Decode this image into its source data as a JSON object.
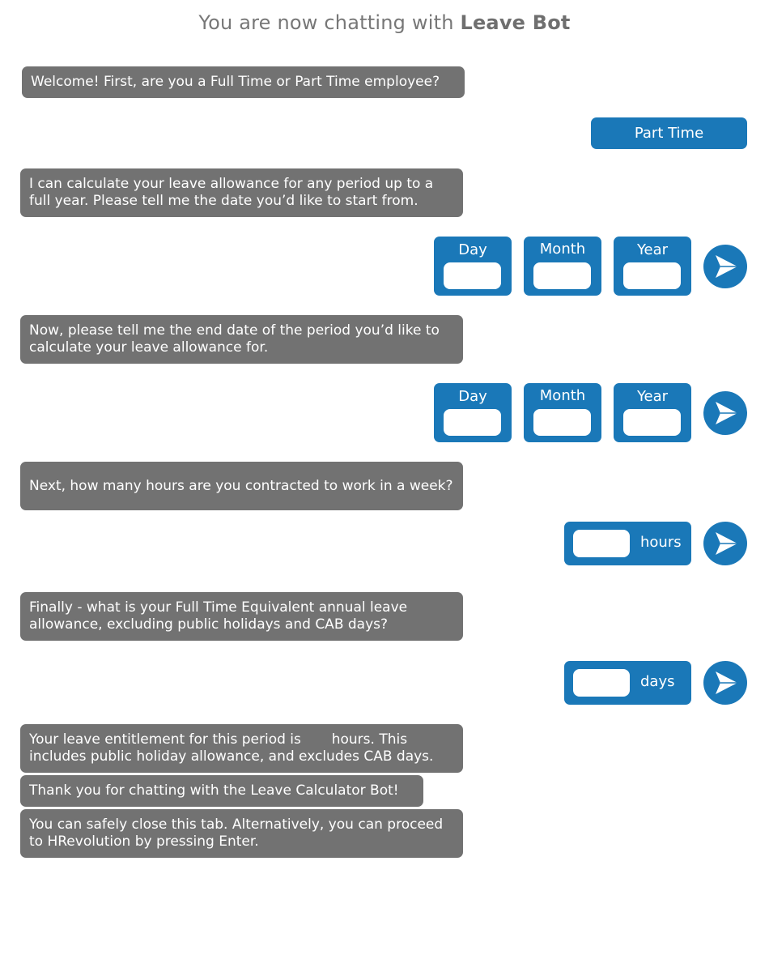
{
  "header": {
    "prefix": "You are now chatting with",
    "bot_name": "Leave Bot"
  },
  "messages": {
    "welcome": "Welcome! First, are you a Full Time or Part Time employee?",
    "start_prompt": "I can calculate your leave allowance for any period up to a full year. Please tell me the date you’d like to start from.",
    "end_prompt": "Now, please tell me the end date of the period you’d like to calculate your leave allowance for.",
    "hours_prompt": "Next, how many hours are you contracted to work in a week?",
    "fte_prompt": "Finally - what is your Full Time Equivalent annual leave allowance, excluding public holidays and CAB days?",
    "result": "Your leave entitlement for this period is       hours. This includes public holiday allowance, and excludes CAB days.",
    "thanks": "Thank you for chatting with the Leave Calculator Bot!",
    "closing": "You can safely close this tab. Alternatively, you can proceed to HRevolution by pressing Enter."
  },
  "user_reply": {
    "employment_type": "Part Time"
  },
  "date_labels": {
    "day": "Day",
    "month": "Month",
    "year": "Year"
  },
  "start_date": {
    "day": "",
    "month": "",
    "year": ""
  },
  "end_date": {
    "day": "",
    "month": "",
    "year": ""
  },
  "hours_input": {
    "value": "",
    "unit": "hours"
  },
  "days_input": {
    "value": "",
    "unit": "days"
  },
  "icons": {
    "send": "send-arrow-icon"
  },
  "colors": {
    "bot_bubble": "#727272",
    "accent": "#1a78b8",
    "header_text": "#777777"
  }
}
